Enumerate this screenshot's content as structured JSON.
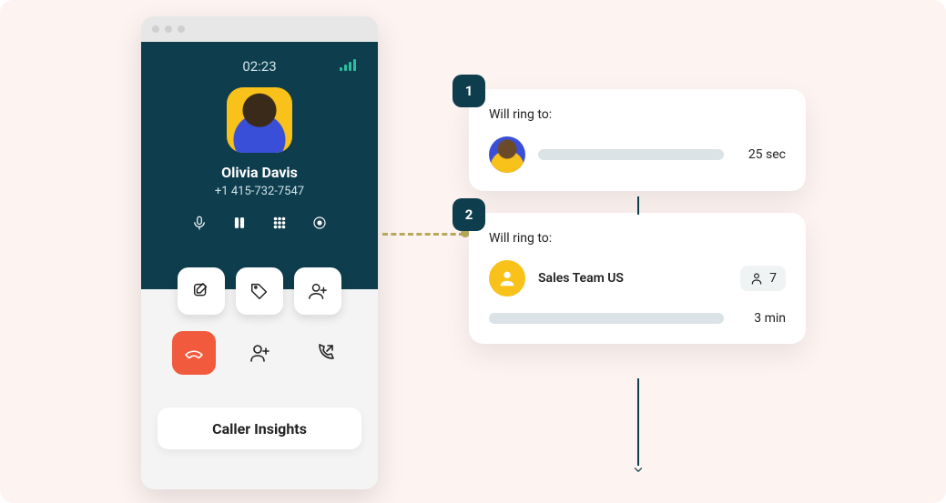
{
  "call": {
    "timer": "02:23",
    "caller_name": "Olivia Davis",
    "caller_number": "+1 415-732-7547"
  },
  "actions": {
    "note": "note",
    "tag": "tag",
    "add_contact": "add_contact",
    "hangup": "hangup",
    "add_user": "add_user",
    "transfer": "transfer"
  },
  "caller_insights_label": "Caller Insights",
  "flow": {
    "step1": {
      "badge": "1",
      "title": "Will ring to:",
      "time": "25 sec"
    },
    "step2": {
      "badge": "2",
      "title": "Will ring to:",
      "team_name": "Sales Team US",
      "team_count": "7",
      "time": "3 min"
    }
  }
}
